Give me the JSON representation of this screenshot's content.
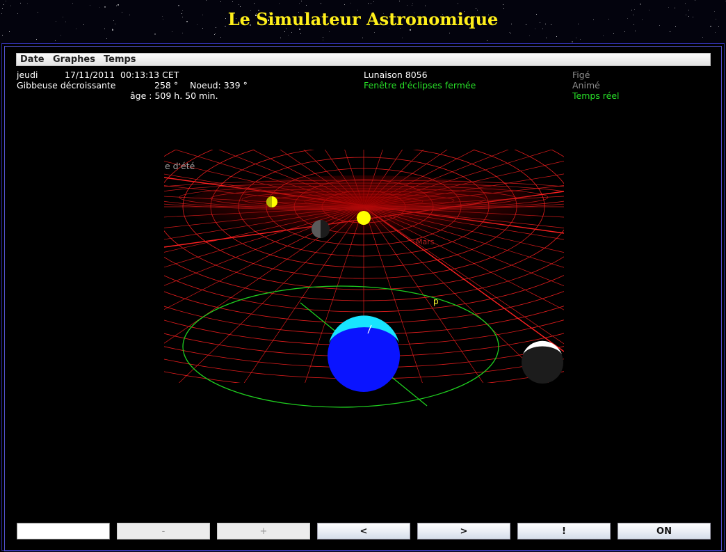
{
  "header": {
    "title": "Le Simulateur Astronomique"
  },
  "menu": [
    {
      "label": "Date"
    },
    {
      "label": "Graphes"
    },
    {
      "label": "Temps"
    }
  ],
  "info": {
    "weekday": "jeudi",
    "date": "17/11/2011",
    "time": "00:13:13 CET",
    "phase": "Gibbeuse décroissante",
    "angle": "258 °",
    "node": "Noeud: 339 °",
    "age": "âge : 509 h. 50 min.",
    "lunation": "Lunaison 8056",
    "eclipse_window": "Fenêtre d'éclipses fermée",
    "modes": [
      "Figé",
      "Animé",
      "Temps réel"
    ],
    "active_mode": "Temps réel"
  },
  "scene": {
    "labels": {
      "solstice": "e d'été",
      "mars": "Mars",
      "perigee": "p"
    },
    "colors": {
      "grid": "#ff2020",
      "orbit": "#1fcf1f",
      "earth": "#0a14ff",
      "earth_day": "#18e4ff",
      "sun": "#ffff00"
    }
  },
  "controls": {
    "input_value": "",
    "buttons": [
      {
        "label": "-",
        "enabled": false
      },
      {
        "label": "+",
        "enabled": false
      },
      {
        "label": "<",
        "enabled": true
      },
      {
        "label": ">",
        "enabled": true
      },
      {
        "label": "!",
        "enabled": true
      },
      {
        "label": "ON",
        "enabled": true
      }
    ]
  }
}
